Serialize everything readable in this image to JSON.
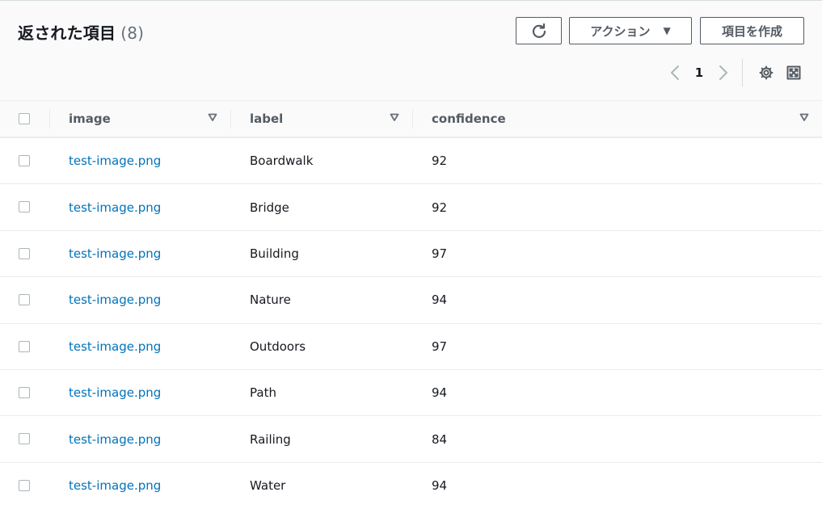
{
  "header": {
    "title": "返された項目",
    "count": "(8)",
    "refresh_icon": "refresh-icon",
    "actions_label": "アクション",
    "create_label": "項目を作成"
  },
  "pagination": {
    "current_page": "1"
  },
  "table": {
    "columns": [
      "image",
      "label",
      "confidence"
    ],
    "rows": [
      {
        "image": "test-image.png",
        "label": "Boardwalk",
        "confidence": "92"
      },
      {
        "image": "test-image.png",
        "label": "Bridge",
        "confidence": "92"
      },
      {
        "image": "test-image.png",
        "label": "Building",
        "confidence": "97"
      },
      {
        "image": "test-image.png",
        "label": "Nature",
        "confidence": "94"
      },
      {
        "image": "test-image.png",
        "label": "Outdoors",
        "confidence": "97"
      },
      {
        "image": "test-image.png",
        "label": "Path",
        "confidence": "94"
      },
      {
        "image": "test-image.png",
        "label": "Railing",
        "confidence": "84"
      },
      {
        "image": "test-image.png",
        "label": "Water",
        "confidence": "94"
      }
    ]
  },
  "colors": {
    "link": "#0073bb",
    "text": "#16191f",
    "muted": "#545b64",
    "border": "#eaeded",
    "header_bg": "#fafafa"
  }
}
